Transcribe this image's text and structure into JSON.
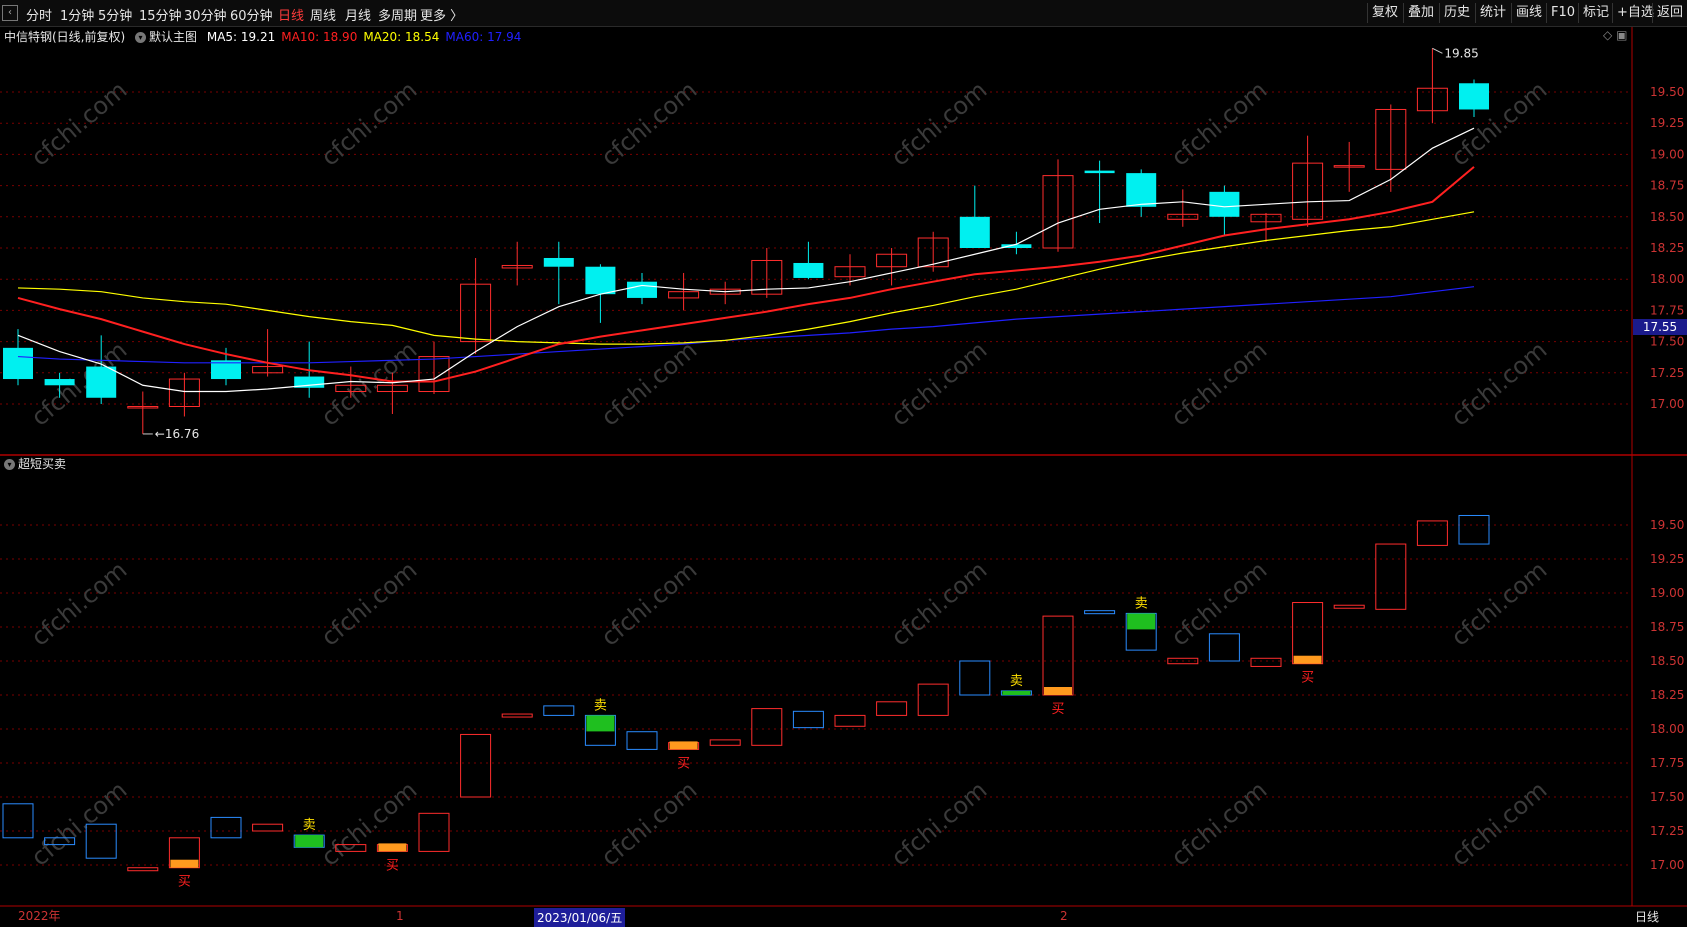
{
  "toolbar": {
    "periods": [
      "分时",
      "1分钟",
      "5分钟",
      "15分钟",
      "30分钟",
      "60分钟",
      "日线",
      "周线",
      "月线",
      "多周期",
      "更多 〉"
    ],
    "active_period": "日线",
    "right_buttons": [
      "复权",
      "叠加",
      "历史",
      "统计",
      "画线",
      "F10",
      "标记",
      "+自选",
      "返回"
    ]
  },
  "main_panel": {
    "stock_name": "中信特钢(日线,前复权)",
    "template_name": "默认主图",
    "ma": [
      {
        "label": "MA5: 19.21",
        "color": "#ffffff"
      },
      {
        "label": "MA10: 18.90",
        "color": "#ff2020"
      },
      {
        "label": "MA20: 18.54",
        "color": "#ffff00"
      },
      {
        "label": "MA60: 17.94",
        "color": "#2020ff"
      }
    ],
    "high_marker": "19.85",
    "low_marker": "16.76",
    "current_price_tag": "17.55",
    "y_ticks": [
      "19.50",
      "19.25",
      "19.00",
      "18.75",
      "18.50",
      "18.25",
      "18.00",
      "17.75",
      "17.50",
      "17.25",
      "17.00"
    ]
  },
  "sub_panel": {
    "title": "超短买卖",
    "y_ticks": [
      "19.50",
      "19.25",
      "19.00",
      "18.75",
      "18.50",
      "18.25",
      "18.00",
      "17.75",
      "17.50",
      "17.25",
      "17.00"
    ],
    "buy_label": "买",
    "sell_label": "卖"
  },
  "bottom_axis": {
    "year_label": "2022年",
    "month_1": "1",
    "month_2": "2",
    "date_badge": "2023/01/06/五",
    "period_badge": "日线"
  },
  "watermark": "cfchi.com",
  "colors": {
    "up": "#ff2d2d",
    "down": "#00f0f0",
    "ma5": "#ffffff",
    "ma10": "#ff2020",
    "ma20": "#ffff00",
    "ma60": "#2020ff",
    "grid": "#7a0000",
    "active": "#ff3b3b"
  },
  "chart_data": {
    "type": "candlestick",
    "candles": [
      {
        "o": 17.45,
        "h": 17.6,
        "l": 17.15,
        "c": 17.2
      },
      {
        "o": 17.2,
        "h": 17.25,
        "l": 17.05,
        "c": 17.15
      },
      {
        "o": 17.3,
        "h": 17.55,
        "l": 17.0,
        "c": 17.05
      },
      {
        "o": 16.98,
        "h": 17.1,
        "l": 16.76,
        "c": 16.98
      },
      {
        "o": 16.98,
        "h": 17.25,
        "l": 16.9,
        "c": 17.2
      },
      {
        "o": 17.35,
        "h": 17.45,
        "l": 17.15,
        "c": 17.2
      },
      {
        "o": 17.25,
        "h": 17.6,
        "l": 17.22,
        "c": 17.3
      },
      {
        "o": 17.22,
        "h": 17.5,
        "l": 17.05,
        "c": 17.13
      },
      {
        "o": 17.1,
        "h": 17.3,
        "l": 17.05,
        "c": 17.15
      },
      {
        "o": 17.1,
        "h": 17.25,
        "l": 16.92,
        "c": 17.15
      },
      {
        "o": 17.1,
        "h": 17.5,
        "l": 17.08,
        "c": 17.38
      },
      {
        "o": 17.5,
        "h": 18.17,
        "l": 17.4,
        "c": 17.96
      },
      {
        "o": 18.09,
        "h": 18.3,
        "l": 17.95,
        "c": 18.11
      },
      {
        "o": 18.17,
        "h": 18.3,
        "l": 17.8,
        "c": 18.1
      },
      {
        "o": 18.1,
        "h": 18.12,
        "l": 17.65,
        "c": 17.88
      },
      {
        "o": 17.98,
        "h": 18.05,
        "l": 17.8,
        "c": 17.85
      },
      {
        "o": 17.85,
        "h": 18.05,
        "l": 17.75,
        "c": 17.9
      },
      {
        "o": 17.88,
        "h": 17.98,
        "l": 17.8,
        "c": 17.92
      },
      {
        "o": 17.88,
        "h": 18.25,
        "l": 17.85,
        "c": 18.15
      },
      {
        "o": 18.13,
        "h": 18.3,
        "l": 18.0,
        "c": 18.01
      },
      {
        "o": 18.02,
        "h": 18.2,
        "l": 17.95,
        "c": 18.1
      },
      {
        "o": 18.1,
        "h": 18.25,
        "l": 17.95,
        "c": 18.2
      },
      {
        "o": 18.1,
        "h": 18.38,
        "l": 18.06,
        "c": 18.33
      },
      {
        "o": 18.5,
        "h": 18.75,
        "l": 18.25,
        "c": 18.25
      },
      {
        "o": 18.28,
        "h": 18.38,
        "l": 18.2,
        "c": 18.25
      },
      {
        "o": 18.25,
        "h": 18.96,
        "l": 18.22,
        "c": 18.83
      },
      {
        "o": 18.87,
        "h": 18.95,
        "l": 18.45,
        "c": 18.85
      },
      {
        "o": 18.85,
        "h": 18.88,
        "l": 18.5,
        "c": 18.58
      },
      {
        "o": 18.48,
        "h": 18.72,
        "l": 18.42,
        "c": 18.52
      },
      {
        "o": 18.7,
        "h": 18.75,
        "l": 18.35,
        "c": 18.5
      },
      {
        "o": 18.46,
        "h": 18.53,
        "l": 18.3,
        "c": 18.52
      },
      {
        "o": 18.48,
        "h": 19.15,
        "l": 18.42,
        "c": 18.93
      },
      {
        "o": 18.91,
        "h": 19.1,
        "l": 18.7,
        "c": 18.91
      },
      {
        "o": 18.88,
        "h": 19.4,
        "l": 18.7,
        "c": 19.36
      },
      {
        "o": 19.35,
        "h": 19.85,
        "l": 19.25,
        "c": 19.53
      },
      {
        "o": 19.57,
        "h": 19.6,
        "l": 19.3,
        "c": 19.36
      }
    ],
    "ma5": [
      17.55,
      17.42,
      17.32,
      17.15,
      17.1,
      17.1,
      17.12,
      17.15,
      17.18,
      17.17,
      17.2,
      17.42,
      17.62,
      17.78,
      17.88,
      17.95,
      17.92,
      17.9,
      17.92,
      17.93,
      17.98,
      18.05,
      18.12,
      18.2,
      18.28,
      18.45,
      18.56,
      18.6,
      18.62,
      18.58,
      18.6,
      18.62,
      18.63,
      18.8,
      19.05,
      19.21
    ],
    "ma10": [
      17.85,
      17.76,
      17.68,
      17.58,
      17.48,
      17.4,
      17.33,
      17.27,
      17.23,
      17.18,
      17.18,
      17.26,
      17.37,
      17.48,
      17.54,
      17.59,
      17.64,
      17.69,
      17.74,
      17.8,
      17.85,
      17.92,
      17.98,
      18.04,
      18.07,
      18.1,
      18.14,
      18.19,
      18.27,
      18.35,
      18.4,
      18.44,
      18.48,
      18.54,
      18.62,
      18.9
    ],
    "ma20": [
      17.93,
      17.92,
      17.9,
      17.85,
      17.82,
      17.8,
      17.75,
      17.7,
      17.66,
      17.63,
      17.55,
      17.52,
      17.5,
      17.49,
      17.48,
      17.48,
      17.49,
      17.51,
      17.55,
      17.6,
      17.66,
      17.73,
      17.79,
      17.86,
      17.92,
      18.0,
      18.08,
      18.15,
      18.21,
      18.26,
      18.31,
      18.35,
      18.39,
      18.42,
      18.48,
      18.54
    ],
    "ma60": [
      17.38,
      17.36,
      17.35,
      17.34,
      17.33,
      17.33,
      17.33,
      17.33,
      17.34,
      17.35,
      17.36,
      17.38,
      17.4,
      17.42,
      17.44,
      17.46,
      17.48,
      17.51,
      17.53,
      17.55,
      17.57,
      17.6,
      17.62,
      17.65,
      17.68,
      17.7,
      17.72,
      17.74,
      17.76,
      17.78,
      17.8,
      17.82,
      17.84,
      17.86,
      17.9,
      17.94
    ],
    "signals": [
      {
        "i": 4,
        "type": "buy"
      },
      {
        "i": 7,
        "type": "sell"
      },
      {
        "i": 9,
        "type": "buy"
      },
      {
        "i": 14,
        "type": "sell"
      },
      {
        "i": 16,
        "type": "buy"
      },
      {
        "i": 24,
        "type": "sell"
      },
      {
        "i": 25,
        "type": "buy"
      },
      {
        "i": 27,
        "type": "sell"
      },
      {
        "i": 31,
        "type": "buy"
      }
    ],
    "y_range_main": [
      16.65,
      19.95
    ],
    "y_range_sub": [
      16.85,
      19.7
    ]
  }
}
